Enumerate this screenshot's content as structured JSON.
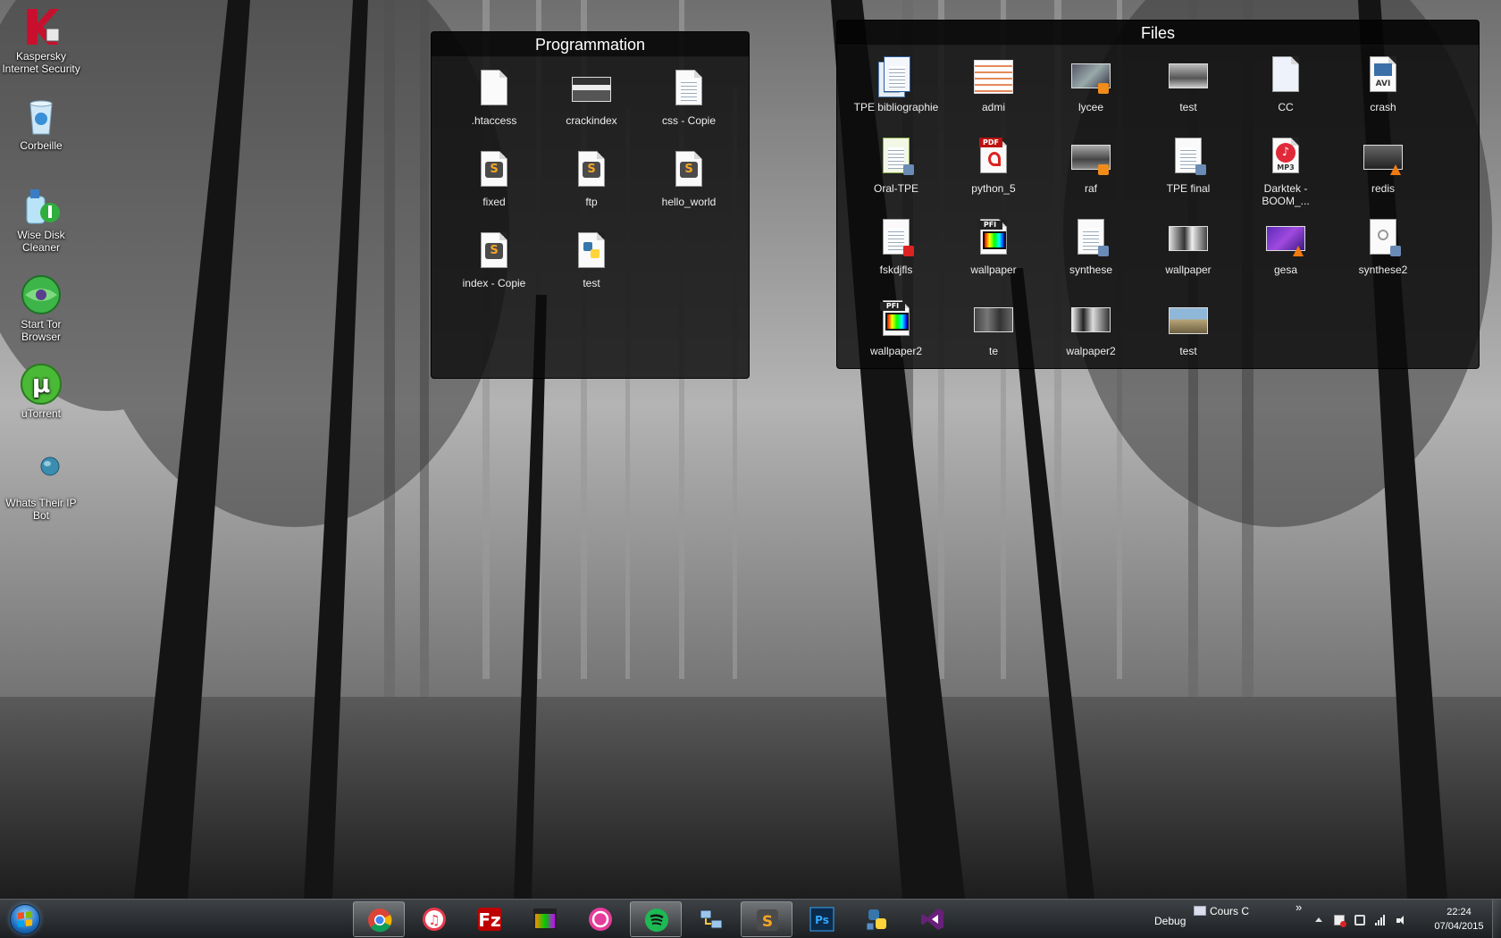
{
  "desktop_icons": [
    {
      "label": "Kaspersky Internet Security",
      "icon": "kaspersky-icon"
    },
    {
      "label": "Corbeille",
      "icon": "recycle-bin-icon"
    },
    {
      "label": "Wise Disk Cleaner",
      "icon": "wise-disk-cleaner-icon"
    },
    {
      "label": "Start Tor Browser",
      "icon": "tor-browser-icon"
    },
    {
      "label": "uTorrent",
      "icon": "utorrent-icon"
    },
    {
      "label": "Whats Their IP Bot",
      "icon": "globe-icon"
    }
  ],
  "fences": {
    "programmation": {
      "title": "Programmation",
      "items": [
        {
          "label": ".htaccess",
          "icon": "blank-file-icon"
        },
        {
          "label": "crackindex",
          "icon": "web-page-thumbnail-icon"
        },
        {
          "label": "css - Copie",
          "icon": "text-file-icon"
        },
        {
          "label": "fixed",
          "icon": "sublime-file-icon"
        },
        {
          "label": "ftp",
          "icon": "sublime-file-icon"
        },
        {
          "label": "hello_world",
          "icon": "sublime-file-icon"
        },
        {
          "label": "index - Copie",
          "icon": "sublime-file-icon"
        },
        {
          "label": "test",
          "icon": "python-file-icon"
        }
      ]
    },
    "files": {
      "title": "Files",
      "items": [
        {
          "label": "TPE bibliographie",
          "icon": "bibliography-doc-icon"
        },
        {
          "label": "admi",
          "icon": "document-thumbnail-icon"
        },
        {
          "label": "lycee",
          "icon": "video-file-icon"
        },
        {
          "label": "test",
          "icon": "image-thumbnail-icon"
        },
        {
          "label": "CC",
          "icon": "text-file-icon"
        },
        {
          "label": "crash",
          "icon": "avi-file-icon"
        },
        {
          "label": "Oral-TPE",
          "icon": "word-doc-icon"
        },
        {
          "label": "python_5",
          "icon": "pdf-file-icon"
        },
        {
          "label": "raf",
          "icon": "video-file-icon"
        },
        {
          "label": "TPE final",
          "icon": "word-doc-icon"
        },
        {
          "label": "Darktek - BOOM_...",
          "icon": "mp3-file-icon"
        },
        {
          "label": "redis",
          "icon": "vlc-video-icon"
        },
        {
          "label": "fskdjfls",
          "icon": "pdf-doc-icon"
        },
        {
          "label": "wallpaper",
          "icon": "pfi-file-icon"
        },
        {
          "label": "synthese",
          "icon": "word-doc-icon"
        },
        {
          "label": "wallpaper",
          "icon": "image-thumbnail-icon"
        },
        {
          "label": "gesa",
          "icon": "vlc-video-icon"
        },
        {
          "label": "synthese2",
          "icon": "word-doc-icon"
        },
        {
          "label": "wallpaper2",
          "icon": "pfi-file-icon"
        },
        {
          "label": "te",
          "icon": "image-thumbnail-icon"
        },
        {
          "label": "walpaper2",
          "icon": "image-thumbnail-icon"
        },
        {
          "label": "test",
          "icon": "image-thumbnail-icon"
        }
      ]
    }
  },
  "taskbar": {
    "apps": [
      {
        "name": "chrome",
        "icon": "chrome-icon",
        "active": true
      },
      {
        "name": "itunes",
        "icon": "itunes-icon",
        "active": false
      },
      {
        "name": "filezilla",
        "icon": "filezilla-icon",
        "active": false
      },
      {
        "name": "fl-studio",
        "icon": "fl-studio-icon",
        "active": false
      },
      {
        "name": "utorrent-music",
        "icon": "music-app-icon",
        "active": false
      },
      {
        "name": "spotify",
        "icon": "spotify-icon",
        "active": true
      },
      {
        "name": "network",
        "icon": "network-icon",
        "active": false
      },
      {
        "name": "sublime-text",
        "icon": "sublime-text-icon",
        "active": true
      },
      {
        "name": "photoshop",
        "icon": "photoshop-icon",
        "active": false
      },
      {
        "name": "python",
        "icon": "python-icon",
        "active": false
      },
      {
        "name": "visual-studio",
        "icon": "visual-studio-icon",
        "active": false
      }
    ],
    "tray": {
      "debug_label": "Debug",
      "toolbar_label": "Cours C",
      "chevron": "»",
      "time": "22:24",
      "date": "07/04/2015"
    }
  },
  "colors": {
    "fence_bg": "#0c0c0c",
    "taskbar_top": "#3e4246",
    "taskbar_bottom": "#1c1f22"
  }
}
